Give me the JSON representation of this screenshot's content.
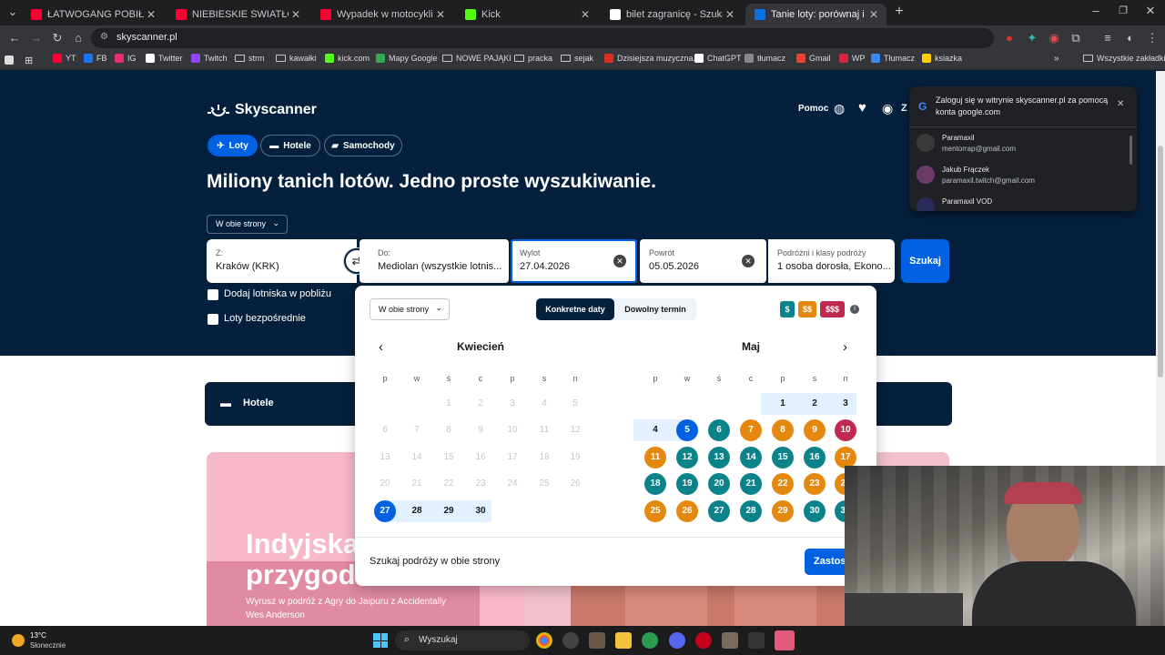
{
  "browser": {
    "tabs": [
      {
        "title": "ŁATWOGANG POBIŁ REKORD Ś",
        "color": "#ff0033"
      },
      {
        "title": "NIEBIESKIE ŚWIATŁO - YouTube",
        "color": "#ff0033"
      },
      {
        "title": "Wypadek w motocyklisty i rowe",
        "color": "#ff0033"
      },
      {
        "title": "Kick",
        "color": "#53fc18"
      },
      {
        "title": "bilet zagranicę - Szukaj w Goog",
        "color": "#ffffff"
      },
      {
        "title": "Tanie loty: porównaj i zarezerw",
        "color": "#0770e3"
      }
    ],
    "url": "skyscanner.pl",
    "bookmarks": [
      "YT",
      "FB",
      "IG",
      "Twitter",
      "Twitch",
      "strm",
      "kawałki",
      "kick.com",
      "Mapy Google",
      "NOWE PAJĄKI",
      "pracka",
      "sejak",
      "Dzisiejsza muzyczna...",
      "ChatGPT",
      "tłumacz",
      "Gmail",
      "WP",
      "Tłumacz",
      "ksiazka"
    ],
    "all_bookmarks": "Wszystkie zakładki"
  },
  "header": {
    "logo": "Skyscanner",
    "help": "Pomoc",
    "user_initial": "Z"
  },
  "nav": {
    "flights": "Loty",
    "hotels": "Hotele",
    "cars": "Samochody"
  },
  "hero_title": "Miliony tanich lotów. Jedno proste wyszukiwanie.",
  "trip_type": "W obie strony",
  "search": {
    "from_label": "Z:",
    "from_value": "Kraków (KRK)",
    "to_label": "Do:",
    "to_value": "Mediolan (wszystkie lotnis...",
    "depart_label": "Wylot",
    "depart_value": "27.04.2026",
    "return_label": "Powrót",
    "return_value": "05.05.2026",
    "travellers_label": "Podróżni i klasy podróży",
    "travellers_value": "1 osoba dorosła, Ekono...",
    "search_button": "Szukaj",
    "nearby": "Dodaj lotniska w pobliżu",
    "direct": "Loty bezpośrednie"
  },
  "calendar": {
    "trip_type": "W obie strony",
    "tab_exact": "Konkretne daty",
    "tab_flex": "Dowolny termin",
    "price_low": "$",
    "price_mid": "$$",
    "price_high": "$$$",
    "month_left": "Kwiecień",
    "month_right": "Maj",
    "weekdays": [
      "p",
      "w",
      "ś",
      "c",
      "p",
      "s",
      "n"
    ],
    "footer_text": "Szukaj podróży w obie strony",
    "apply_button": "Zastosuj",
    "colors": {
      "green": "#0c838a",
      "orange": "#e5880f",
      "red": "#c12a50",
      "selected": "#0062e3"
    }
  },
  "below_hero": {
    "hotels_label": "Hotele",
    "promo_title_line1": "Indyjska",
    "promo_title_line2": "przygoda",
    "promo_text_line1": "Wyrusz w podróż z Agry do Jaipuru z Accidentally",
    "promo_text_line2": "Wes Anderson"
  },
  "google_popup": {
    "title": "Zaloguj się w witrynie skyscanner.pl za pomocą konta google.com",
    "accounts": [
      {
        "name": "Paramaxil",
        "email": "mentorrap@gmail.com"
      },
      {
        "name": "Jakub Frączek",
        "email": "paramaxil.twitch@gmail.com"
      },
      {
        "name": "Paramaxil VOD",
        "email": ""
      }
    ]
  },
  "taskbar": {
    "temperature": "13°C",
    "weather": "Słonecznie",
    "search": "Wyszukaj"
  }
}
